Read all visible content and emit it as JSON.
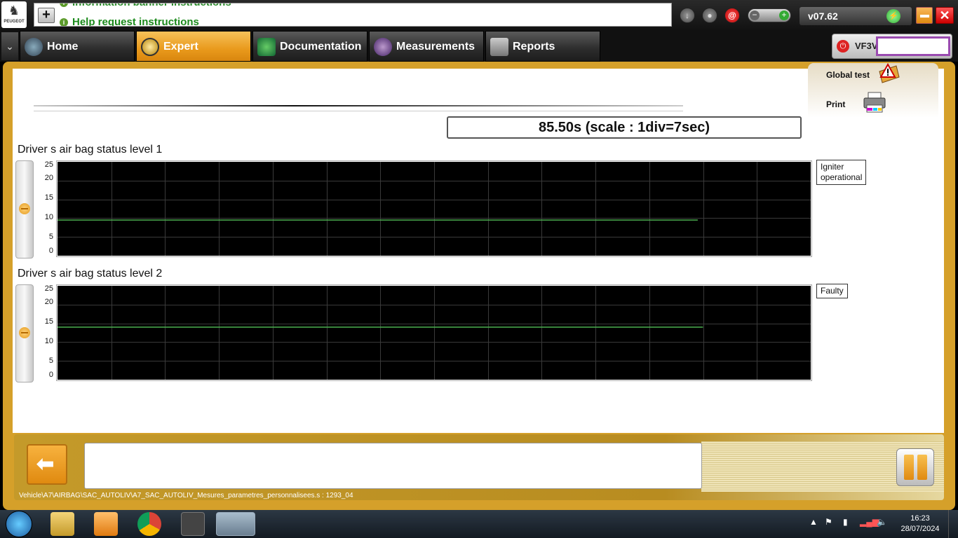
{
  "logo": {
    "brand": "PEUGEOT"
  },
  "banner": {
    "line1": "Information banner instructions",
    "line2": "Help request instructions"
  },
  "header": {
    "version": "v07.62"
  },
  "nav": {
    "tabs": [
      {
        "label": "Home",
        "icon": "home-icon",
        "active": false
      },
      {
        "label": "Expert",
        "icon": "magnifier-icon",
        "active": true
      },
      {
        "label": "Documentation",
        "icon": "book-icon",
        "active": false
      },
      {
        "label": "Measurements",
        "icon": "waveform-icon",
        "active": false
      },
      {
        "label": "Reports",
        "icon": "report-icon",
        "active": false
      }
    ],
    "vin_prefix": "VF3V",
    "vin_value": ""
  },
  "side_panel": {
    "global_test": "Global test",
    "print": "Print"
  },
  "time_display": "85.50s (scale : 1div=7sec)",
  "chart_data": [
    {
      "type": "line",
      "title": "Driver s air bag status level 1",
      "yticks": [
        "25",
        "20",
        "15",
        "10",
        "5",
        "0"
      ],
      "ylim": [
        0,
        25
      ],
      "x_divisions": 14,
      "seconds_per_division": 7,
      "grid": true,
      "background": "#000000",
      "line_color": "#4caf50",
      "series": [
        {
          "values": [
            9.5,
            9.5
          ],
          "x_end_fraction": 0.85
        }
      ],
      "legend": "Igniter operational",
      "legend_lines": [
        "Igniter",
        "operational"
      ]
    },
    {
      "type": "line",
      "title": "Driver s air bag status level 2",
      "yticks": [
        "25",
        "20",
        "15",
        "10",
        "5",
        "0"
      ],
      "ylim": [
        0,
        25
      ],
      "x_divisions": 14,
      "seconds_per_division": 7,
      "grid": true,
      "background": "#000000",
      "line_color": "#4caf50",
      "series": [
        {
          "values": [
            14,
            14
          ],
          "x_end_fraction": 0.857
        }
      ],
      "legend": "Faulty",
      "legend_lines": [
        "Faulty"
      ]
    }
  ],
  "footer": {
    "path": "Vehicle\\A7\\AIRBAG\\SAC_AUTOLIV\\A7_SAC_AUTOLIV_Mesures_parametres_personnalisees.s : 1293_04",
    "message": ""
  },
  "taskbar": {
    "apps": [
      "start-orb",
      "file-explorer-icon",
      "media-player-icon",
      "chrome-icon",
      "toggle-app-icon",
      "diagbox-icon"
    ],
    "time": "16:23",
    "date": "28/07/2024"
  },
  "colors": {
    "accent": "#e99a1c",
    "frame": "#d5a02a",
    "vin_border": "#9a4bb0"
  }
}
